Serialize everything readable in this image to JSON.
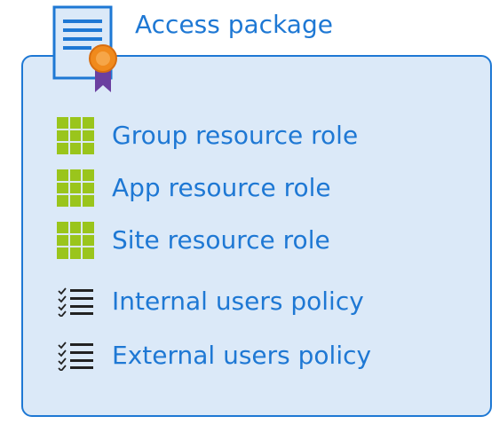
{
  "package": {
    "title": "Access package",
    "icon": "certificate-icon"
  },
  "items": [
    {
      "label": "Group resource role",
      "icon": "resource-grid-icon"
    },
    {
      "label": "App resource role",
      "icon": "resource-grid-icon"
    },
    {
      "label": "Site resource role",
      "icon": "resource-grid-icon"
    },
    {
      "label": "Internal users policy",
      "icon": "checklist-icon"
    },
    {
      "label": "External users policy",
      "icon": "checklist-icon"
    }
  ],
  "colors": {
    "accent": "#1e78d4",
    "box_fill": "#dbe9f8",
    "resource_green": "#9ac51c",
    "badge_orange": "#f08a1c",
    "ribbon_purple": "#6b3fa0"
  }
}
